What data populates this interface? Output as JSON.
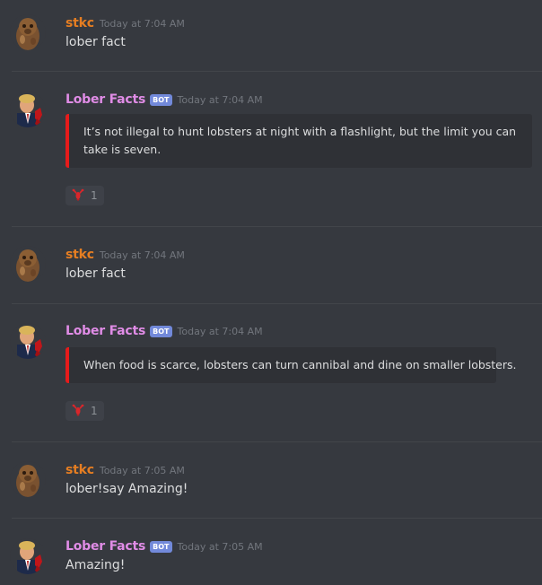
{
  "messages": [
    {
      "author": "stkc",
      "timestamp": "Today at 7:04 AM",
      "text": "lober fact"
    },
    {
      "author": "Lober Facts",
      "badge": "BOT",
      "timestamp": "Today at 7:04 AM",
      "embed_text": "It’s not illegal to hunt lobsters at night with a flashlight, but the limit you can take is seven.",
      "reaction": {
        "emoji": "lobster-icon",
        "count": "1"
      }
    },
    {
      "author": "stkc",
      "timestamp": "Today at 7:04 AM",
      "text": "lober fact"
    },
    {
      "author": "Lober Facts",
      "badge": "BOT",
      "timestamp": "Today at 7:04 AM",
      "embed_text": "When food is scarce, lobsters can turn cannibal and dine on smaller lobsters.",
      "reaction": {
        "emoji": "lobster-icon",
        "count": "1"
      }
    },
    {
      "author": "stkc",
      "timestamp": "Today at 7:05 AM",
      "text": "lober!say Amazing!"
    },
    {
      "author": "Lober Facts",
      "badge": "BOT",
      "timestamp": "Today at 7:05 AM",
      "text": "Amazing!"
    }
  ],
  "colors": {
    "background": "#36393f",
    "embed_background": "#2f3136",
    "embed_border": "#e61b1b",
    "user_name": "#e67e22",
    "bot_name": "#e08ce6",
    "bot_badge": "#7289da",
    "timestamp": "#72767d"
  }
}
